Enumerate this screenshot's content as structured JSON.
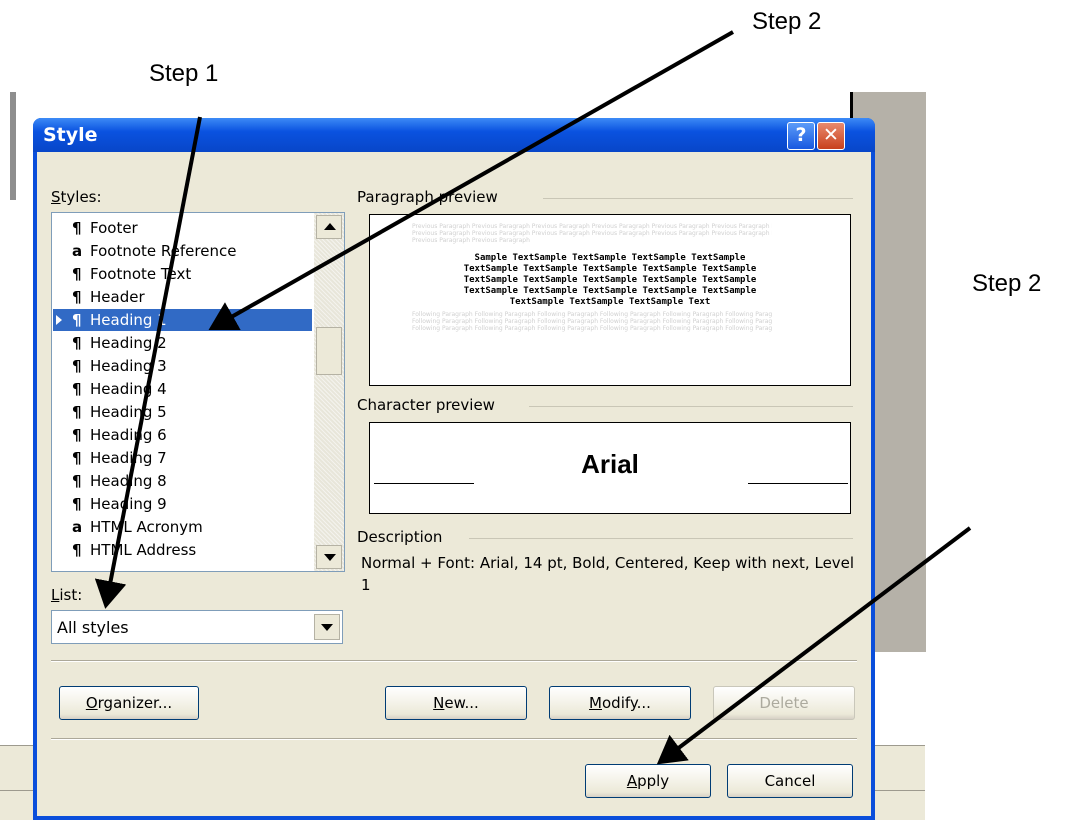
{
  "dialog": {
    "title": "Style",
    "help_glyph": "?",
    "close_glyph": "✕",
    "styles_label_u": "S",
    "styles_label_rest": "tyles:",
    "styles_items": [
      {
        "glyph": "¶",
        "label": "Footer"
      },
      {
        "glyph": "a",
        "label": "Footnote Reference"
      },
      {
        "glyph": "¶",
        "label": "Footnote Text"
      },
      {
        "glyph": "¶",
        "label": "Header"
      },
      {
        "glyph": "¶",
        "label": "Heading 1"
      },
      {
        "glyph": "¶",
        "label": "Heading 2"
      },
      {
        "glyph": "¶",
        "label": "Heading 3"
      },
      {
        "glyph": "¶",
        "label": "Heading 4"
      },
      {
        "glyph": "¶",
        "label": "Heading 5"
      },
      {
        "glyph": "¶",
        "label": "Heading 6"
      },
      {
        "glyph": "¶",
        "label": "Heading 7"
      },
      {
        "glyph": "¶",
        "label": "Heading 8"
      },
      {
        "glyph": "¶",
        "label": "Heading 9"
      },
      {
        "glyph": "a",
        "label": "HTML Acronym"
      },
      {
        "glyph": "¶",
        "label": "HTML Address"
      }
    ],
    "selected_style": "Heading 1",
    "list_label_u": "L",
    "list_label_rest": "ist:",
    "list_value": "All styles",
    "paragraph_preview_label": "Paragraph preview",
    "preview_faint_text": "Previous Paragraph Previous Paragraph Previous Paragraph Previous Paragraph Previous Paragraph Previous Paragraph Previous Paragraph Previous Paragraph",
    "preview_following_text": "Following Paragraph Following Paragraph Following Paragraph Following Paragraph Following Paragraph Following Paragraph Following Paragraph",
    "preview_sample_lines": [
      "Sample TextSample TextSample TextSample TextSample",
      "TextSample TextSample TextSample TextSample TextSample",
      "TextSample TextSample TextSample TextSample TextSample",
      "TextSample TextSample TextSample TextSample TextSample",
      "TextSample TextSample TextSample Text"
    ],
    "character_preview_label": "Character preview",
    "character_preview_text": "Arial",
    "description_label": "Description",
    "description_text": "Normal + Font: Arial, 14 pt, Bold, Centered, Keep with next, Level 1",
    "buttons": {
      "organizer_u": "O",
      "organizer_rest": "rganizer...",
      "new_u": "N",
      "new_rest": "ew...",
      "modify_u": "M",
      "modify_rest": "odify...",
      "delete": "Delete",
      "apply_u": "A",
      "apply_rest": "pply",
      "cancel": "Cancel"
    }
  },
  "annotations": {
    "step1": "Step 1",
    "step2_top": "Step 2",
    "step2_right": "Step 2"
  }
}
